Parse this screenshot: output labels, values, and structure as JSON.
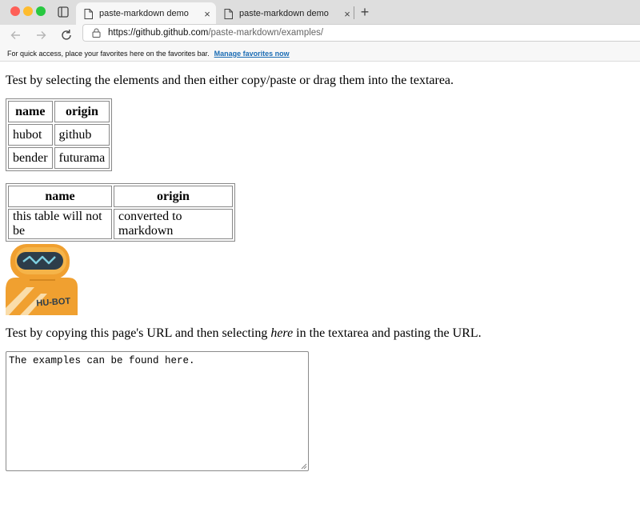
{
  "browser": {
    "tabs": [
      {
        "title": "paste-markdown demo",
        "active": true
      },
      {
        "title": "paste-markdown demo",
        "active": false
      }
    ],
    "tab_close_glyph": "×",
    "new_tab_glyph": "+",
    "address": {
      "host": "https://github.github.com",
      "path": "/paste-markdown/examples/"
    },
    "favorites_bar": {
      "text": "For quick access, place your favorites here on the favorites bar.",
      "link": "Manage favorites now"
    }
  },
  "page": {
    "intro": "Test by selecting the elements and then either copy/paste or drag them into the textarea.",
    "table1": {
      "headers": [
        "name",
        "origin"
      ],
      "rows": [
        [
          "hubot",
          "github"
        ],
        [
          "bender",
          "futurama"
        ]
      ]
    },
    "table2": {
      "headers": [
        "name",
        "origin"
      ],
      "rows": [
        [
          "this table will not be",
          "converted to markdown"
        ]
      ]
    },
    "image_label": "HU-BOT",
    "url_instructions": {
      "before": "Test by copying this page's URL and then selecting ",
      "emphasis": "here",
      "after": " in the textarea and pasting the URL."
    },
    "textarea_value": "The examples can be found here."
  },
  "colors": {
    "hubot_orange": "#f0a030",
    "hubot_dark": "#2d3d4a",
    "hubot_visor": "#7ecfe0",
    "link": "#1a6cb4"
  }
}
